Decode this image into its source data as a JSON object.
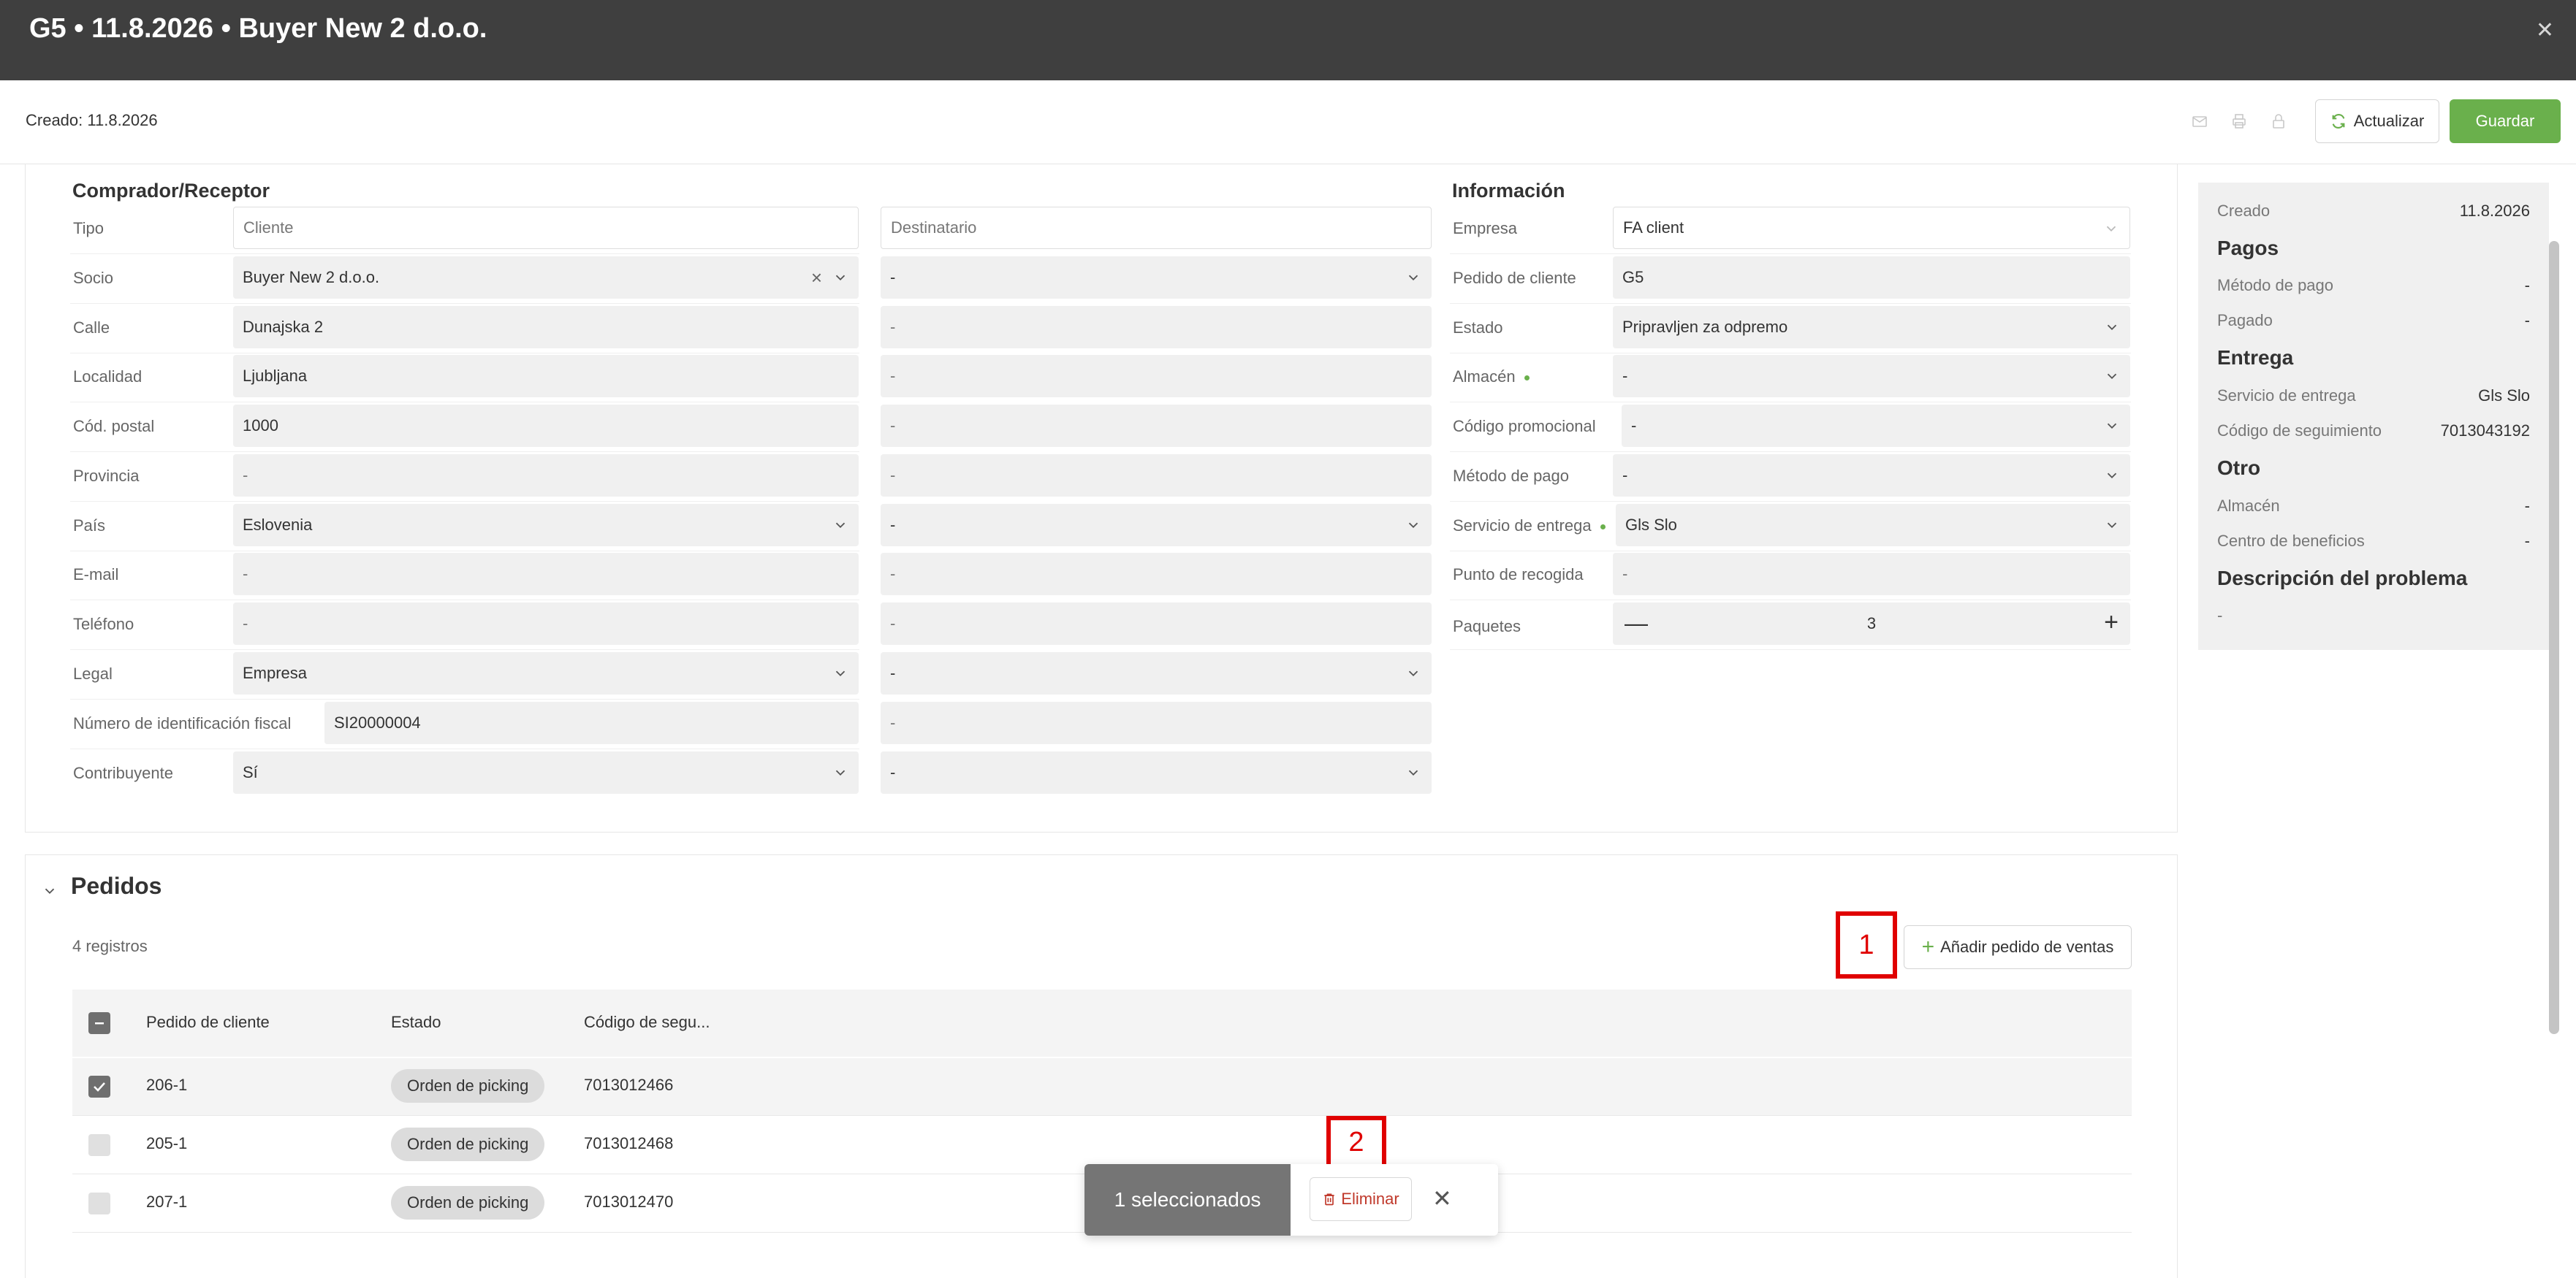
{
  "header": {
    "title": "G5 • 11.8.2026 • Buyer New 2 d.o.o."
  },
  "toolbar": {
    "created": "Creado: 11.8.2026",
    "refresh_label": "Actualizar",
    "save_label": "Guardar"
  },
  "buyer": {
    "section_title": "Comprador/Receptor",
    "type_label": "Tipo",
    "type_value": "Cliente",
    "recipient_value": "Destinatario",
    "partner_label": "Socio",
    "partner_value": "Buyer New 2 d.o.o.",
    "street_label": "Calle",
    "street_value": "Dunajska 2",
    "city_label": "Localidad",
    "city_value": "Ljubljana",
    "postal_label": "Cód. postal",
    "postal_value": "1000",
    "province_label": "Provincia",
    "province_value": "-",
    "country_label": "País",
    "country_value": "Eslovenia",
    "email_label": "E-mail",
    "email_value": "-",
    "phone_label": "Teléfono",
    "phone_value": "-",
    "legal_label": "Legal",
    "legal_value": "Empresa",
    "tax_label": "Número de identificación fiscal",
    "tax_value": "SI20000004",
    "taxpayer_label": "Contribuyente",
    "taxpayer_value": "Sí",
    "empty": "-"
  },
  "info": {
    "section_title": "Información",
    "company_label": "Empresa",
    "company_value": "FA client",
    "order_label": "Pedido de cliente",
    "order_value": "G5",
    "status_label": "Estado",
    "status_value": "Pripravljen za odpremo",
    "warehouse_label": "Almacén",
    "warehouse_value": "-",
    "promo_label": "Código promocional",
    "promo_value": "-",
    "payment_label": "Método de pago",
    "payment_value": "-",
    "delivery_label": "Servicio de entrega",
    "delivery_value": "Gls Slo",
    "pickup_label": "Punto de recogida",
    "pickup_value": "-",
    "packages_label": "Paquetes",
    "packages_value": "3"
  },
  "side": {
    "created_k": "Creado",
    "created_v": "11.8.2026",
    "payments_h": "Pagos",
    "method_k": "Método de pago",
    "method_v": "-",
    "paid_k": "Pagado",
    "paid_v": "-",
    "delivery_h": "Entrega",
    "service_k": "Servicio de entrega",
    "service_v": "Gls Slo",
    "tracking_k": "Código de seguimiento",
    "tracking_v": "7013043192",
    "other_h": "Otro",
    "warehouse_k": "Almacén",
    "warehouse_v": "-",
    "profit_k": "Centro de beneficios",
    "profit_v": "-",
    "problem_h": "Descripción del problema",
    "problem_v": "-"
  },
  "orders": {
    "title": "Pedidos",
    "count": "4 registros",
    "add_label": "Añadir pedido de ventas",
    "columns": [
      "Pedido de cliente",
      "Estado",
      "Código de segu..."
    ],
    "rows": [
      {
        "order": "206-1",
        "status": "Orden de picking",
        "tracking": "7013012466",
        "selected": true
      },
      {
        "order": "205-1",
        "status": "Orden de picking",
        "tracking": "7013012468",
        "selected": false
      },
      {
        "order": "207-1",
        "status": "Orden de picking",
        "tracking": "7013012470",
        "selected": false
      }
    ]
  },
  "marks": {
    "one": "1",
    "two": "2"
  },
  "toast": {
    "count_label": "1 seleccionados",
    "delete_label": "Eliminar"
  }
}
